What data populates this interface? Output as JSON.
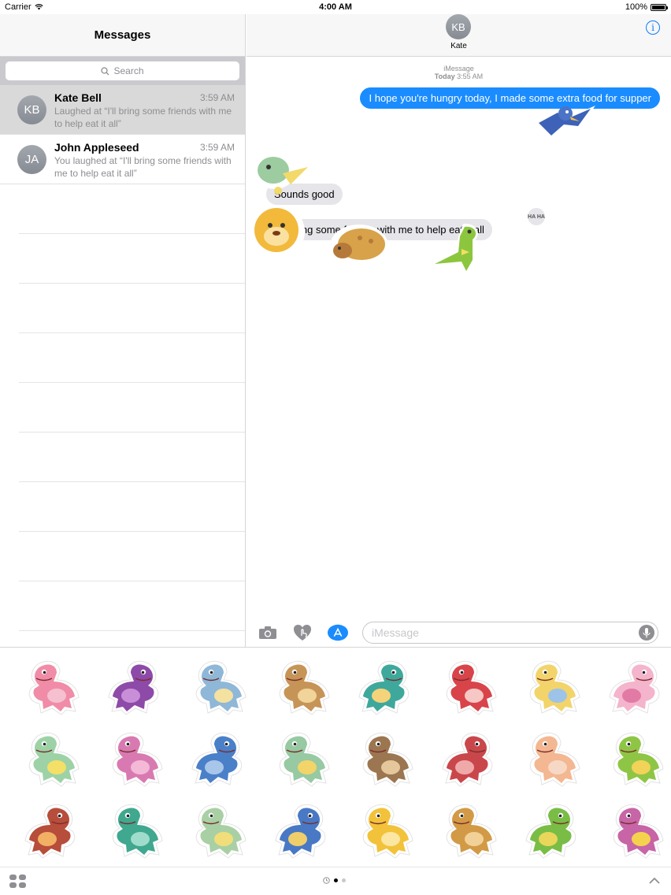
{
  "status_bar": {
    "carrier": "Carrier",
    "time": "4:00 AM",
    "battery": "100%",
    "battery_level": 1.0
  },
  "sidebar": {
    "title": "Messages",
    "search_placeholder": "Search",
    "conversations": [
      {
        "initials": "KB",
        "name": "Kate Bell",
        "time": "3:59 AM",
        "preview": "Laughed at “I'll bring some friends with me to help eat it all”",
        "selected": true
      },
      {
        "initials": "JA",
        "name": "John Appleseed",
        "time": "3:59 AM",
        "preview": "You laughed at “I'll bring some friends with me to help eat it all”",
        "selected": false
      }
    ]
  },
  "conversation": {
    "contact_initials": "KB",
    "contact_name": "Kate",
    "service": "iMessage",
    "date_label": "Today",
    "date_time": "3:55 AM",
    "messages": [
      {
        "direction": "outgoing",
        "text": "I hope you're hungry today, I made some extra food for supper"
      },
      {
        "direction": "incoming",
        "text": "Sounds good"
      },
      {
        "direction": "incoming",
        "text": "I'll bring some friends with me to help eat it all"
      }
    ],
    "tapback": "HA HA",
    "composer_placeholder": "iMessage"
  },
  "colors": {
    "accent": "#1a8cff",
    "incoming_bubble": "#e5e5ea",
    "avatar": "#8e939b"
  },
  "sticker_drawer": {
    "page_count": 2,
    "current_page": 1,
    "stickers": [
      {
        "name": "pink-pachycephalosaurus",
        "body": "#f08ca8",
        "accent": "#f5c0cf"
      },
      {
        "name": "purple-pterosaur",
        "body": "#8e4aa8",
        "accent": "#c88fd8"
      },
      {
        "name": "blue-raptor",
        "body": "#8fb7d8",
        "accent": "#f5e2a0"
      },
      {
        "name": "brown-raptor",
        "body": "#c79457",
        "accent": "#f0d49a"
      },
      {
        "name": "teal-trex",
        "body": "#3fa89c",
        "accent": "#f5d37a"
      },
      {
        "name": "red-triceratops",
        "body": "#d8444a",
        "accent": "#f5c7c5"
      },
      {
        "name": "yellow-pteranodon",
        "body": "#f2d46b",
        "accent": "#9dc3e8"
      },
      {
        "name": "pink-longneck",
        "body": "#f4b4cc",
        "accent": "#e27aa6"
      },
      {
        "name": "green-dino-yellow-crest",
        "body": "#9dd2a6",
        "accent": "#f4e067"
      },
      {
        "name": "pink-parasaurolophus",
        "body": "#d87ab1",
        "accent": "#f3b9d7"
      },
      {
        "name": "blue-brachiosaurus",
        "body": "#4a80c8",
        "accent": "#a7c6ea"
      },
      {
        "name": "green-stegosaurus",
        "body": "#97c9a2",
        "accent": "#f3d469"
      },
      {
        "name": "brown-trex",
        "body": "#9b7650",
        "accent": "#e4c79b"
      },
      {
        "name": "red-trex",
        "body": "#c9474b",
        "accent": "#f0a9a9"
      },
      {
        "name": "peach-dino",
        "body": "#f3b791",
        "accent": "#f6d8c5"
      },
      {
        "name": "green-spinosaurus",
        "body": "#8fc545",
        "accent": "#f1d35a"
      },
      {
        "name": "red-brown-allosaurus",
        "body": "#b74d3b",
        "accent": "#f2b064"
      },
      {
        "name": "teal-longneck",
        "body": "#3fa88f",
        "accent": "#a0dccb"
      },
      {
        "name": "green-pterosaur",
        "body": "#a9d0a4",
        "accent": "#f1de7a"
      },
      {
        "name": "blue-dilophosaurus",
        "body": "#4979c4",
        "accent": "#f0ce6a"
      },
      {
        "name": "yellow-triceratops",
        "body": "#f2c23a",
        "accent": "#fbe6a2"
      },
      {
        "name": "orange-ankylosaurus",
        "body": "#d29a46",
        "accent": "#f2d198"
      },
      {
        "name": "green-dino",
        "body": "#79bd46",
        "accent": "#e9d65b"
      },
      {
        "name": "purple-pink-dino",
        "body": "#c765a7",
        "accent": "#f5d24d"
      }
    ]
  }
}
